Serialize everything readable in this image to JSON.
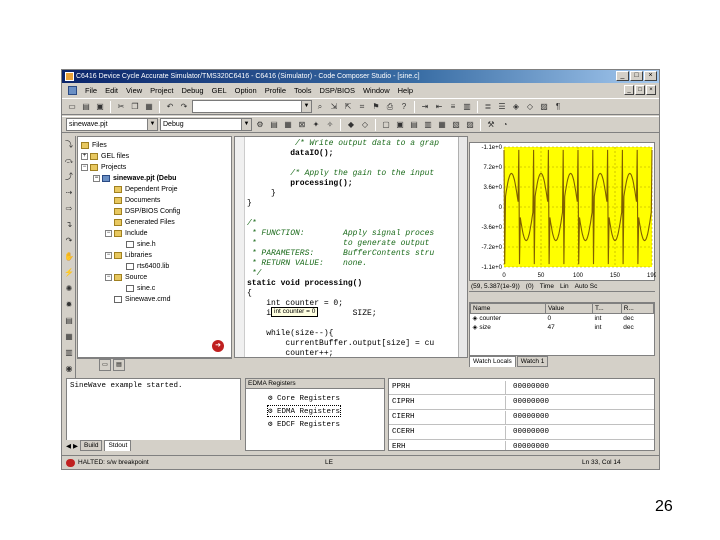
{
  "window": {
    "title": "C6416 Device Cycle Accurate Simulator/TMS320C6416 - C6416 (Simulator) - Code Composer Studio - [sine.c]",
    "controls": [
      "_",
      "□",
      "×"
    ]
  },
  "menubar": {
    "items": [
      "File",
      "Edit",
      "View",
      "Project",
      "Debug",
      "GEL",
      "Option",
      "Profile",
      "Tools",
      "DSP/BIOS",
      "Window",
      "Help"
    ],
    "mdi_controls": [
      "_",
      "□",
      "×"
    ]
  },
  "toolbar2": {
    "project_combo": "sinewave.pjt",
    "config_combo": "Debug"
  },
  "filetree": {
    "items": [
      {
        "label": "Files",
        "icon": "folder",
        "level": 0
      },
      {
        "label": "GEL files",
        "icon": "folder",
        "level": 1,
        "toggle": "+"
      },
      {
        "label": "Projects",
        "icon": "folder",
        "level": 1,
        "toggle": "-"
      },
      {
        "label": "sinewave.pjt (Debu",
        "icon": "project",
        "level": 2,
        "toggle": "-",
        "bold": true
      },
      {
        "label": "Dependent Proje",
        "icon": "folder",
        "level": 3
      },
      {
        "label": "Documents",
        "icon": "folder",
        "level": 3
      },
      {
        "label": "DSP/BIOS Config",
        "icon": "folder",
        "level": 3
      },
      {
        "label": "Generated Files",
        "icon": "folder",
        "level": 3
      },
      {
        "label": "Include",
        "icon": "folder",
        "level": 3,
        "toggle": "-"
      },
      {
        "label": "sine.h",
        "icon": "file",
        "level": 4
      },
      {
        "label": "Libraries",
        "icon": "folder",
        "level": 3,
        "toggle": "-"
      },
      {
        "label": "rts6400.lib",
        "icon": "file",
        "level": 4
      },
      {
        "label": "Source",
        "icon": "folder",
        "level": 3,
        "toggle": "-"
      },
      {
        "label": "sine.c",
        "icon": "file",
        "level": 4
      },
      {
        "label": "Sinewave.cmd",
        "icon": "file",
        "level": 3
      }
    ]
  },
  "editor": {
    "lines": [
      {
        "text": "          /* Write output data to a grap",
        "cls": "cmt"
      },
      {
        "text": "         dataIO();",
        "cls": "kw"
      },
      {
        "text": "",
        "cls": ""
      },
      {
        "text": "         /* Apply the gain to the input",
        "cls": "cmt"
      },
      {
        "text": "         processing();",
        "cls": "kw"
      },
      {
        "text": "     }",
        "cls": ""
      },
      {
        "text": "}",
        "cls": ""
      },
      {
        "text": "",
        "cls": ""
      },
      {
        "text": "/*",
        "cls": "cmt"
      },
      {
        "text": " * FUNCTION:        Apply signal proces",
        "cls": "cmt"
      },
      {
        "text": " *                  to generate output",
        "cls": "cmt"
      },
      {
        "text": " * PARAMETERS:      BufferContents stru",
        "cls": "cmt"
      },
      {
        "text": " * RETURN VALUE:    none.",
        "cls": "cmt"
      },
      {
        "text": " */",
        "cls": "cmt"
      },
      {
        "text": "static void processing()",
        "cls": "kw"
      },
      {
        "text": "{",
        "cls": ""
      },
      {
        "text": "    int counter = 0;",
        "cls": ""
      },
      {
        "text": "    int               SIZE;",
        "cls": ""
      },
      {
        "text": "",
        "cls": ""
      },
      {
        "text": "    while(size--){",
        "cls": ""
      },
      {
        "text": "        currentBuffer.output[size] = cu",
        "cls": ""
      },
      {
        "text": "        counter++;",
        "cls": ""
      }
    ],
    "tooltip": "int counter = 0"
  },
  "graph": {
    "y_labels": [
      "-1.1e+0",
      "7.2e+0",
      "3.6e+0",
      "0",
      "-3.6e+0",
      "-7.2e+0",
      "-1.1e+0"
    ],
    "x_labels": [
      "0",
      "50",
      "100",
      "150",
      "199"
    ],
    "status": [
      "(59, 5.387(1e-9))",
      "(0)",
      "Time",
      "Lin",
      "Auto Sc"
    ]
  },
  "watch": {
    "columns": [
      "Name",
      "Value",
      "T...",
      "R..."
    ],
    "rows": [
      {
        "name": "counter",
        "value": "0",
        "type": "int",
        "radix": "dec"
      },
      {
        "name": "size",
        "value": "47",
        "type": "int",
        "radix": "dec"
      }
    ],
    "tabs": [
      "Watch Locals",
      "Watch 1"
    ]
  },
  "output": {
    "text": "SineWave example started.",
    "tabs": [
      "Build",
      "Stdout"
    ]
  },
  "edma": {
    "header": "EDMA Registers",
    "items": [
      "Core Registers",
      "EDMA Registers",
      "EDCF Registers"
    ],
    "selected": 1
  },
  "registers": {
    "rows": [
      {
        "name": "PPRH",
        "value": "00000000"
      },
      {
        "name": "CIPRH",
        "value": "00000000"
      },
      {
        "name": "CIERH",
        "value": "00000000"
      },
      {
        "name": "CCERH",
        "value": "00000000"
      },
      {
        "name": "ERH",
        "value": "00000000"
      }
    ]
  },
  "statusbar": {
    "halt": "HALTED: s/w breakpoint",
    "mode": "LE",
    "position": "Ln 33, Col 14"
  },
  "page_number": "26"
}
